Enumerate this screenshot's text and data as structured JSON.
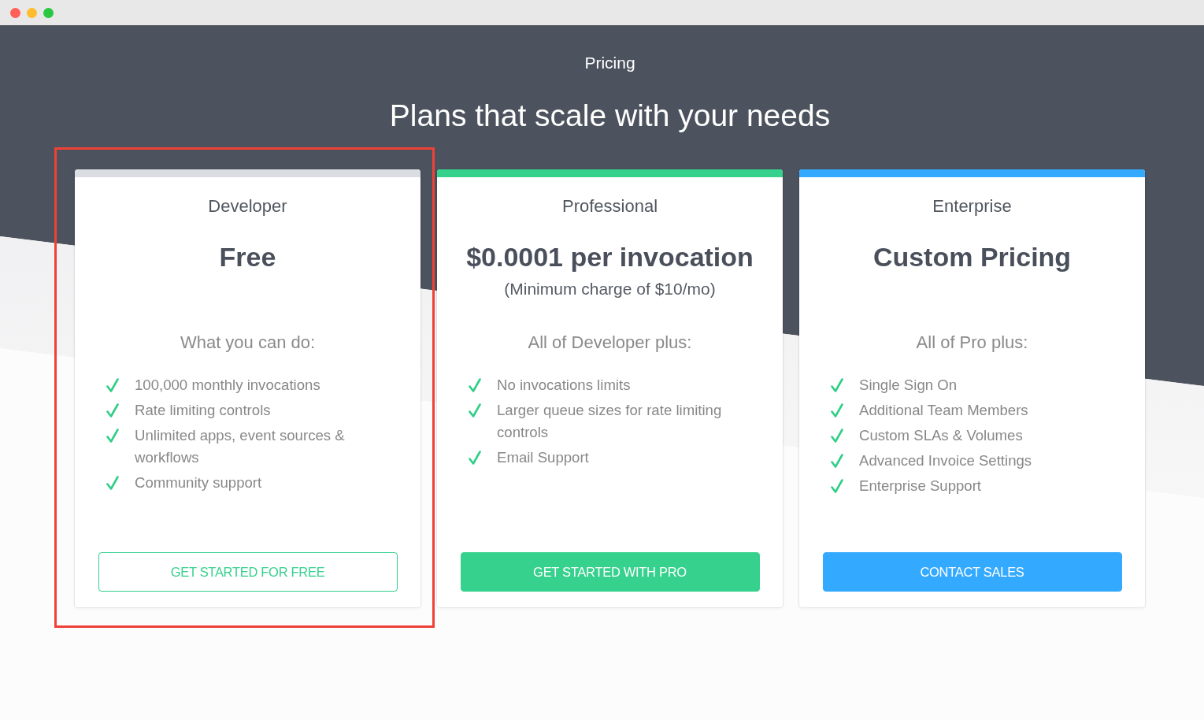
{
  "window": {
    "controls": [
      {
        "color": "#ff5f57"
      },
      {
        "color": "#febc2e"
      },
      {
        "color": "#28c840"
      }
    ]
  },
  "header": {
    "eyebrow": "Pricing",
    "title": "Plans that scale with your needs"
  },
  "plans": [
    {
      "name": "Developer",
      "color": "#dadee2",
      "price": "Free",
      "features_heading": "What you can do:",
      "features": [
        "100,000 monthly invocations",
        "Rate limiting controls",
        "Unlimited apps, event sources & workflows",
        "Community support"
      ],
      "button": {
        "label": "GET STARTED FOR FREE",
        "kind": "outline",
        "color": "#35d18d"
      },
      "highlighted": true
    },
    {
      "name": "Professional",
      "color": "#35d18d",
      "price": "$0.0001 per invocation",
      "note": "(Minimum charge of $10/mo)",
      "features_heading": "All of Developer plus:",
      "features": [
        "No invocations limits",
        "Larger queue sizes for rate limiting controls",
        "Email Support"
      ],
      "button": {
        "label": "GET STARTED WITH PRO",
        "kind": "filled",
        "color": "#35d18d"
      },
      "highlighted": false
    },
    {
      "name": "Enterprise",
      "color": "#33a9ff",
      "price": "Custom Pricing",
      "features_heading": "All of Pro plus:",
      "features": [
        "Single Sign On",
        "Additional Team Members",
        "Custom SLAs & Volumes",
        "Advanced Invoice Settings",
        "Enterprise Support"
      ],
      "button": {
        "label": "CONTACT SALES",
        "kind": "filled",
        "color": "#33a9ff"
      },
      "highlighted": false
    }
  ]
}
